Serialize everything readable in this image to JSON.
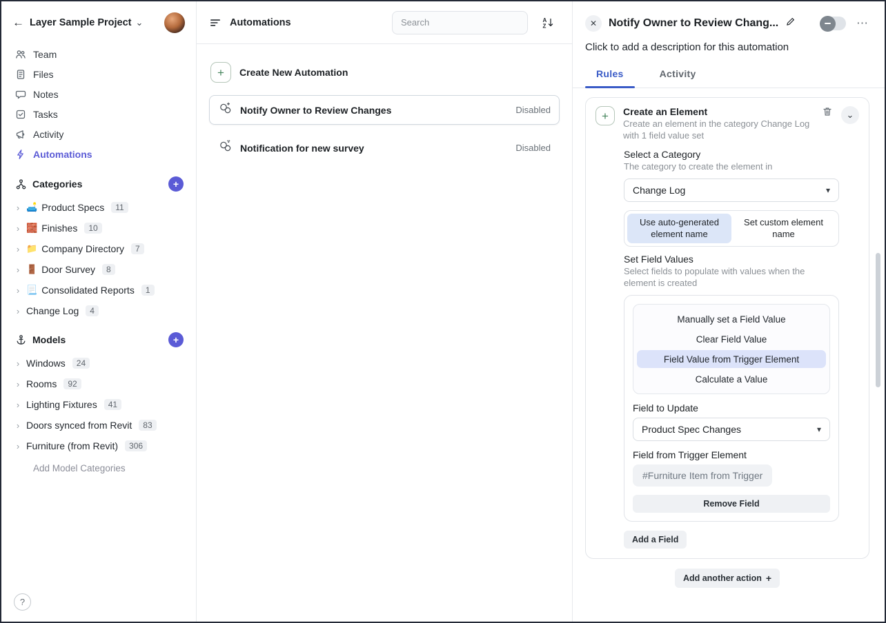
{
  "icons": {
    "plus": "+",
    "close": "✕",
    "more": "⋯",
    "back": "←",
    "chevron_down": "⌄",
    "caret": "›",
    "select_caret": "▾",
    "help": "?"
  },
  "sidebar": {
    "project_title": "Layer Sample Project",
    "nav": [
      {
        "label": "Team"
      },
      {
        "label": "Files"
      },
      {
        "label": "Notes"
      },
      {
        "label": "Tasks"
      },
      {
        "label": "Activity"
      },
      {
        "label": "Automations"
      }
    ],
    "categories_header": "Categories",
    "categories": [
      {
        "emoji": "🛋️",
        "label": "Product Specs",
        "count": "11"
      },
      {
        "emoji": "🧱",
        "label": "Finishes",
        "count": "10"
      },
      {
        "emoji": "📁",
        "label": "Company Directory",
        "count": "7"
      },
      {
        "emoji": "🚪",
        "label": "Door Survey",
        "count": "8"
      },
      {
        "emoji": "📃",
        "label": "Consolidated Reports",
        "count": "1"
      },
      {
        "emoji": "",
        "label": "Change Log",
        "count": "4"
      }
    ],
    "models_header": "Models",
    "models": [
      {
        "label": "Windows",
        "count": "24"
      },
      {
        "label": "Rooms",
        "count": "92"
      },
      {
        "label": "Lighting Fixtures",
        "count": "41"
      },
      {
        "label": "Doors synced from Revit",
        "count": "83"
      },
      {
        "label": "Furniture (from Revit)",
        "count": "306"
      }
    ],
    "add_model_categories": "Add Model Categories"
  },
  "list_panel": {
    "title": "Automations",
    "search_placeholder": "Search",
    "create_new": "Create New Automation",
    "items": [
      {
        "name": "Notify Owner to Review Changes",
        "status": "Disabled"
      },
      {
        "name": "Notification for new survey",
        "status": "Disabled"
      }
    ]
  },
  "detail_panel": {
    "title": "Notify Owner to Review Chang...",
    "description_placeholder": "Click to add a description for this automation",
    "tabs": [
      {
        "label": "Rules"
      },
      {
        "label": "Activity"
      }
    ],
    "card": {
      "title": "Create an Element",
      "subtitle": "Create an element in the category Change Log with 1 field value set",
      "select_category_label": "Select a Category",
      "select_category_help": "The category to create the element in",
      "category_value": "Change Log",
      "name_options": [
        "Use auto-generated element name",
        "Set custom element name"
      ],
      "set_field_values_label": "Set Field Values",
      "set_field_values_help": "Select fields to populate with values when the element is created",
      "field_modes": [
        "Manually set a Field Value",
        "Clear Field Value",
        "Field Value from Trigger Element",
        "Calculate a Value"
      ],
      "field_to_update_label": "Field to Update",
      "field_to_update_value": "Product Spec Changes",
      "field_from_trigger_label": "Field from Trigger Element",
      "field_from_trigger_value": "#Furniture Item from Trigger",
      "remove_field_label": "Remove Field",
      "add_field_label": "Add a Field"
    },
    "add_another_action_label": "Add another action"
  }
}
